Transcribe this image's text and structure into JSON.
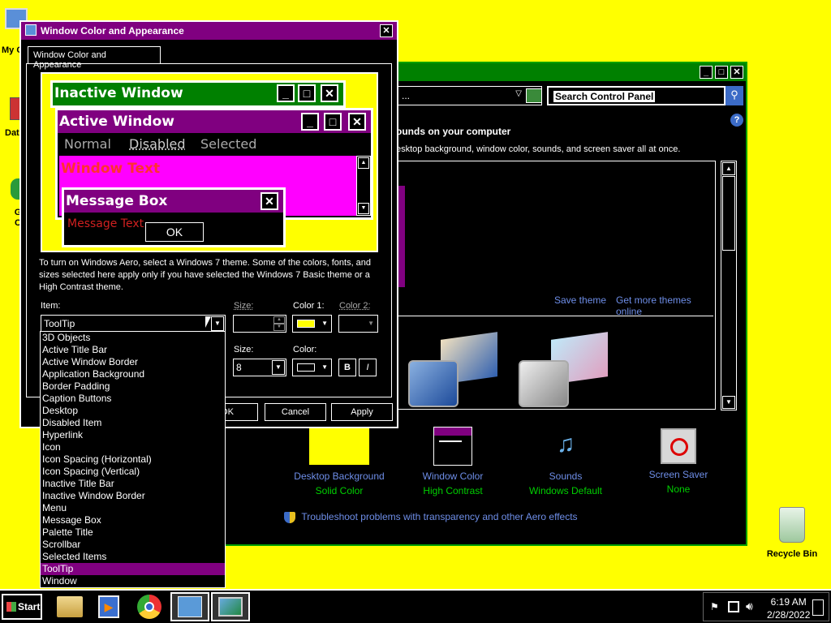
{
  "desktop": {
    "icons": [
      {
        "label": "My C",
        "icon": "computer-icon"
      },
      {
        "label": "Dat",
        "icon": "database-icon"
      },
      {
        "label": "G\nC",
        "icon": "chrome-icon"
      },
      {
        "label": "Recycle Bin",
        "icon": "recycle-bin-icon"
      }
    ]
  },
  "control_panel": {
    "address": "...",
    "search_placeholder": "Search Control Panel",
    "help": "?",
    "heading": "ounds on your computer",
    "subheading": "esktop background, window color, sounds, and screen saver all at once.",
    "save_theme": "Save theme",
    "get_more_themes": "Get more themes online",
    "items": [
      {
        "label": "Desktop Background",
        "sub": "Solid Color",
        "icon": "desktop-background-icon"
      },
      {
        "label": "Window Color",
        "sub": "High Contrast",
        "icon": "window-color-icon"
      },
      {
        "label": "Sounds",
        "sub": "Windows Default",
        "icon": "sounds-icon"
      },
      {
        "label": "Screen Saver",
        "sub": "None",
        "icon": "screen-saver-icon"
      }
    ],
    "troubleshoot": "Troubleshoot problems with transparency and other Aero effects"
  },
  "dialog": {
    "title": "Window Color and Appearance",
    "tab": "Window Color and Appearance",
    "preview": {
      "inactive_window": "Inactive Window",
      "active_window": "Active Window",
      "normal": "Normal",
      "disabled": "Disabled",
      "selected": "Selected",
      "window_text": "Window Text",
      "message_box": "Message Box",
      "message_text": "Message Text",
      "ok": "OK"
    },
    "description": "To turn on Windows Aero, select a Windows 7 theme.  Some of the colors, fonts, and sizes selected here apply only if you have selected the Windows 7 Basic theme or a High Contrast theme.",
    "item_label": "Item:",
    "item_value": "ToolTip",
    "size_label": "Size:",
    "color1_label": "Color 1:",
    "color2_label": "Color 2:",
    "font_size_label": "Size:",
    "font_size_value": "8",
    "font_color_label": "Color:",
    "bold": "B",
    "italic": "I",
    "ok": "OK",
    "cancel": "Cancel",
    "apply": "Apply",
    "color1_value": "#ffff00"
  },
  "item_list": [
    "3D Objects",
    "Active Title Bar",
    "Active Window Border",
    "Application Background",
    "Border Padding",
    "Caption Buttons",
    "Desktop",
    "Disabled Item",
    "Hyperlink",
    "Icon",
    "Icon Spacing (Horizontal)",
    "Icon Spacing (Vertical)",
    "Inactive Title Bar",
    "Inactive Window Border",
    "Menu",
    "Message Box",
    "Palette Title",
    "Scrollbar",
    "Selected Items",
    "ToolTip",
    "Window"
  ],
  "selected_item": "ToolTip",
  "taskbar": {
    "start": "Start",
    "time": "6:19 AM",
    "date": "2/28/2022",
    "apps": [
      "file-explorer-icon",
      "media-player-icon",
      "chrome-icon",
      "control-panel-icon",
      "display-settings-icon"
    ]
  },
  "colors": {
    "desktop": "#ffff00",
    "active_title": "#800080",
    "inactive_title": "#008000",
    "window_bg": "#ff00ff",
    "accent_link": "#6e8ee8"
  }
}
